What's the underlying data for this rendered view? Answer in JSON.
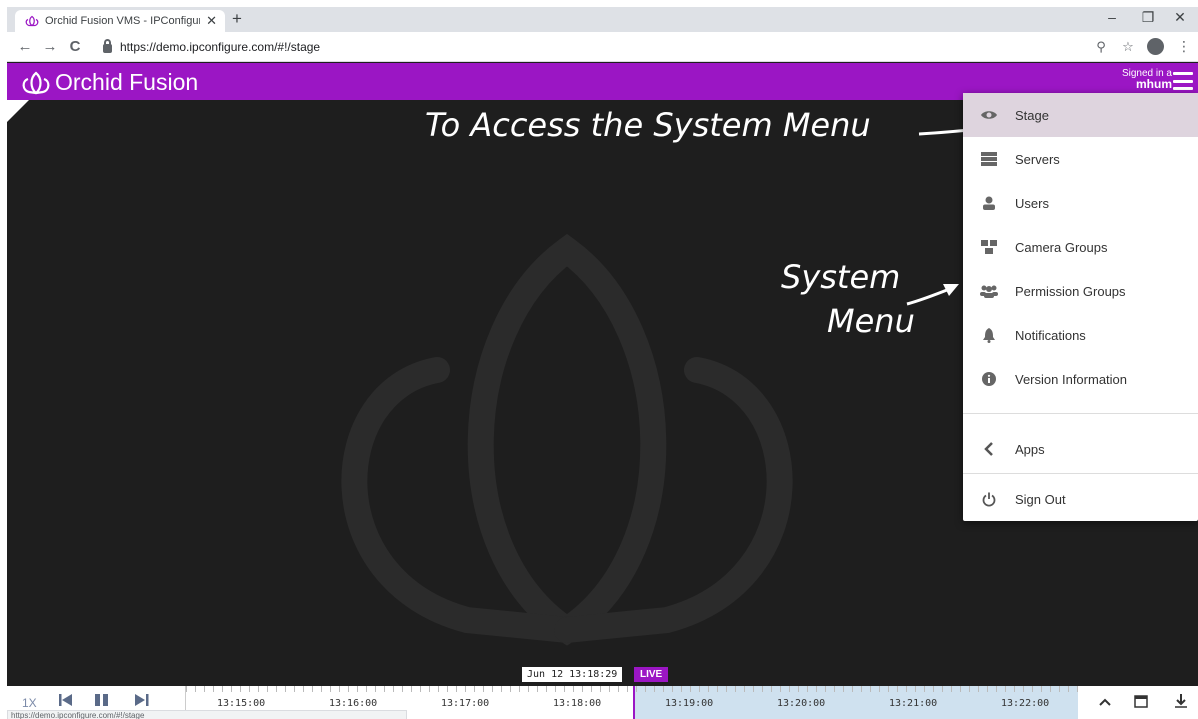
{
  "colors": {
    "brand_purple": "#9b16c4",
    "stage_bg": "#1e1e1e",
    "menu_active": "#ded4de",
    "timeline_future": "#cfe1ef"
  },
  "browser": {
    "tab_title": "Orchid Fusion VMS - IPConfigure",
    "tab_close": "✕",
    "new_tab": "+",
    "minimize": "–",
    "restore": "❐",
    "close": "✕",
    "back": "←",
    "forward": "→",
    "reload": "C",
    "url": "https://demo.ipconfigure.com/#!/stage",
    "zoom_icon": "zoom-icon",
    "star_icon": "star-icon"
  },
  "app": {
    "brand_name": "Orchid Fusion",
    "signed_in_label": "Signed in a",
    "username": "mhum"
  },
  "annotations": {
    "access_menu": "To Access the System Menu",
    "system_menu_line1": "System",
    "system_menu_line2": "Menu"
  },
  "menu": {
    "items": [
      {
        "label": "Stage",
        "icon": "eye-icon"
      },
      {
        "label": "Servers",
        "icon": "server-icon"
      },
      {
        "label": "Users",
        "icon": "user-icon"
      },
      {
        "label": "Camera Groups",
        "icon": "camera-group-icon"
      },
      {
        "label": "Permission Groups",
        "icon": "users-icon"
      },
      {
        "label": "Notifications",
        "icon": "bell-icon"
      },
      {
        "label": "Version Information",
        "icon": "info-icon"
      },
      {
        "label": "Apps",
        "icon": "chevron-left-icon"
      },
      {
        "label": "Sign Out",
        "icon": "power-icon"
      }
    ]
  },
  "timeline": {
    "speed": "1X",
    "current_time": "Jun 12 13:18:29",
    "live_label": "LIVE",
    "ticks": [
      "13:15:00",
      "13:16:00",
      "13:17:00",
      "13:18:00",
      "13:19:00",
      "13:20:00",
      "13:21:00",
      "13:22:00"
    ],
    "status_url": "https://demo.ipconfigure.com/#!/stage"
  }
}
